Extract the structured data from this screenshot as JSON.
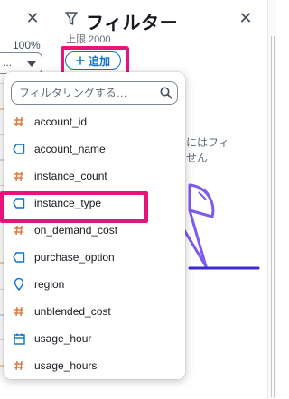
{
  "left_panel": {
    "close_glyph": "✕",
    "zoom": "100%",
    "select_value": "..."
  },
  "filter_panel": {
    "title": "フィルター",
    "close_glyph": "✕",
    "limit_text": "上限 2000",
    "add_button_label": "追加",
    "add_button_icon": "plus-icon",
    "empty_text_line1": "にはフィ",
    "empty_text_line2": "せん"
  },
  "dropdown": {
    "search_placeholder": "フィルタリングする…",
    "items": [
      {
        "label": "account_id",
        "icon": "hash-icon"
      },
      {
        "label": "account_name",
        "icon": "string-tag-icon"
      },
      {
        "label": "instance_count",
        "icon": "hash-icon"
      },
      {
        "label": "instance_type",
        "icon": "string-tag-icon"
      },
      {
        "label": "on_demand_cost",
        "icon": "hash-icon"
      },
      {
        "label": "purchase_option",
        "icon": "string-tag-icon"
      },
      {
        "label": "region",
        "icon": "location-pin-icon"
      },
      {
        "label": "unblended_cost",
        "icon": "hash-icon"
      },
      {
        "label": "usage_hour",
        "icon": "calendar-icon"
      },
      {
        "label": "usage_hours",
        "icon": "hash-icon"
      }
    ],
    "highlighted_item": "instance_type"
  },
  "colors": {
    "accent_blue": "#0972d3",
    "highlight_pink": "#e7157b",
    "number_icon_orange": "#e07941",
    "string_icon_blue": "#0972d3",
    "illustration_purple": "#7f5af0"
  }
}
